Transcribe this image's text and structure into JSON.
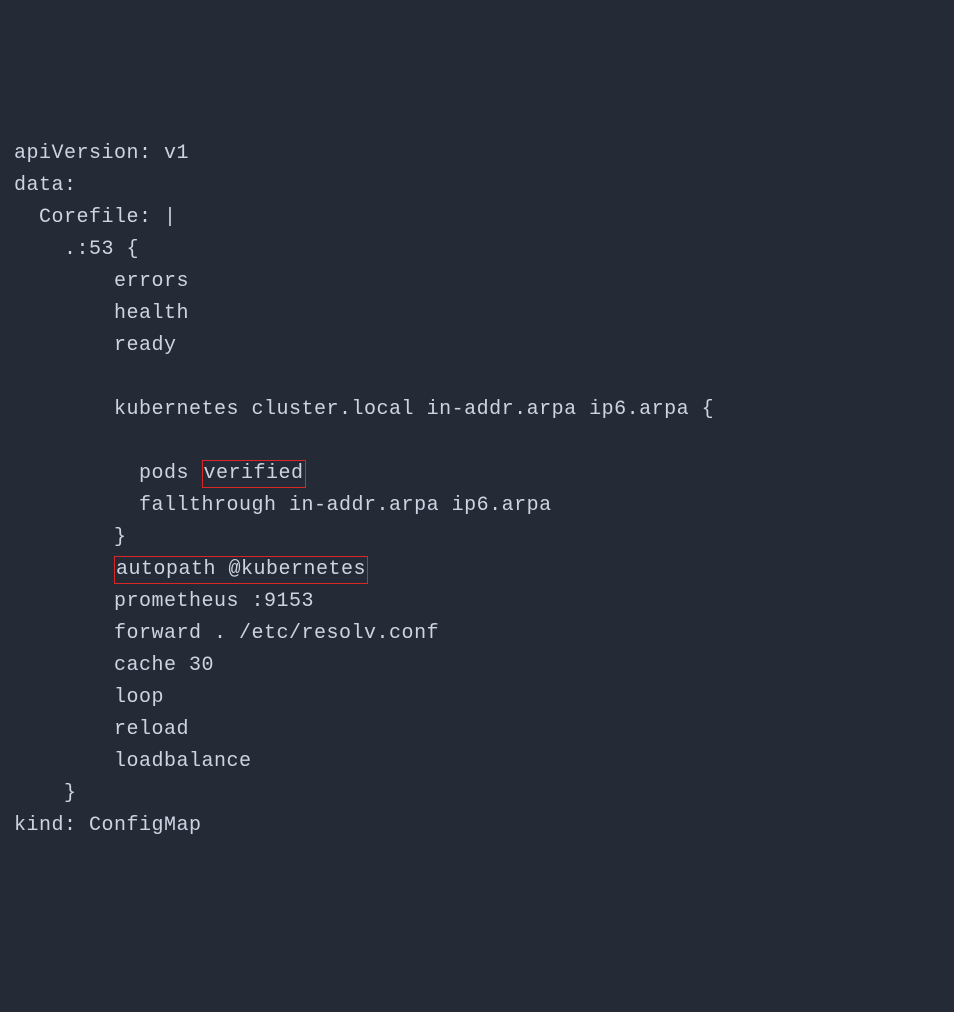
{
  "line1": "apiVersion: v1",
  "line2": "data:",
  "line3": "  Corefile: |",
  "line4": "    .:53 {",
  "line5": "        errors",
  "line6": "        health",
  "line7": "        ready",
  "line8": "",
  "line9": "        kubernetes cluster.local in-addr.arpa ip6.arpa {",
  "line10": "",
  "line11a": "          pods ",
  "line11b": "verified",
  "line12": "          fallthrough in-addr.arpa ip6.arpa",
  "line13": "        }",
  "line14a": "        ",
  "line14b": "autopath @kubernetes",
  "line15": "        prometheus :9153",
  "line16": "        forward . /etc/resolv.conf",
  "line17": "        cache 30",
  "line18": "        loop",
  "line19": "        reload",
  "line20": "        loadbalance",
  "line21": "    }",
  "line22": "kind: ConfigMap"
}
